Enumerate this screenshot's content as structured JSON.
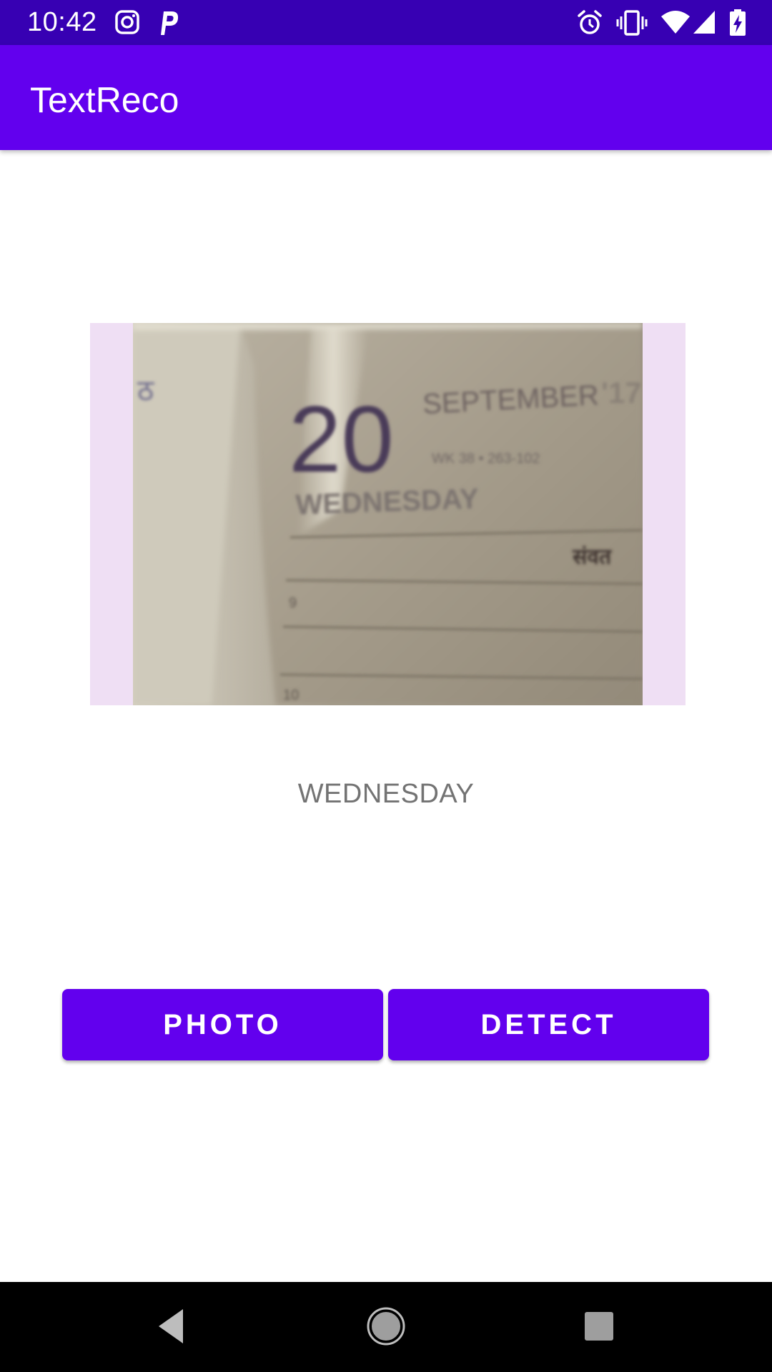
{
  "status_bar": {
    "time": "10:42",
    "icons": [
      "instagram-icon",
      "p-app-icon",
      "alarm-icon",
      "vibrate-icon",
      "wifi-icon",
      "cell-signal-icon",
      "battery-charging-icon"
    ]
  },
  "app_bar": {
    "title": "TextReco"
  },
  "image": {
    "day_number": "20",
    "month": "SEPTEMBER",
    "year_fragment": "'17",
    "small_line": "WK 38 • 263-102",
    "weekday": "WEDNESDAY",
    "hindi_text": "संवत",
    "corner_mark": "ठ",
    "line_9": "9",
    "line_10": "10"
  },
  "result": {
    "text": "WEDNESDAY"
  },
  "buttons": {
    "photo_label": "PHOTO",
    "detect_label": "DETECT"
  },
  "nav_bar": {
    "icons": [
      "back-icon",
      "home-icon",
      "recents-icon"
    ]
  },
  "colors": {
    "status_bar": "#3700b3",
    "primary": "#6200ee",
    "image_background": "#efdff4",
    "result_text": "#737373"
  }
}
